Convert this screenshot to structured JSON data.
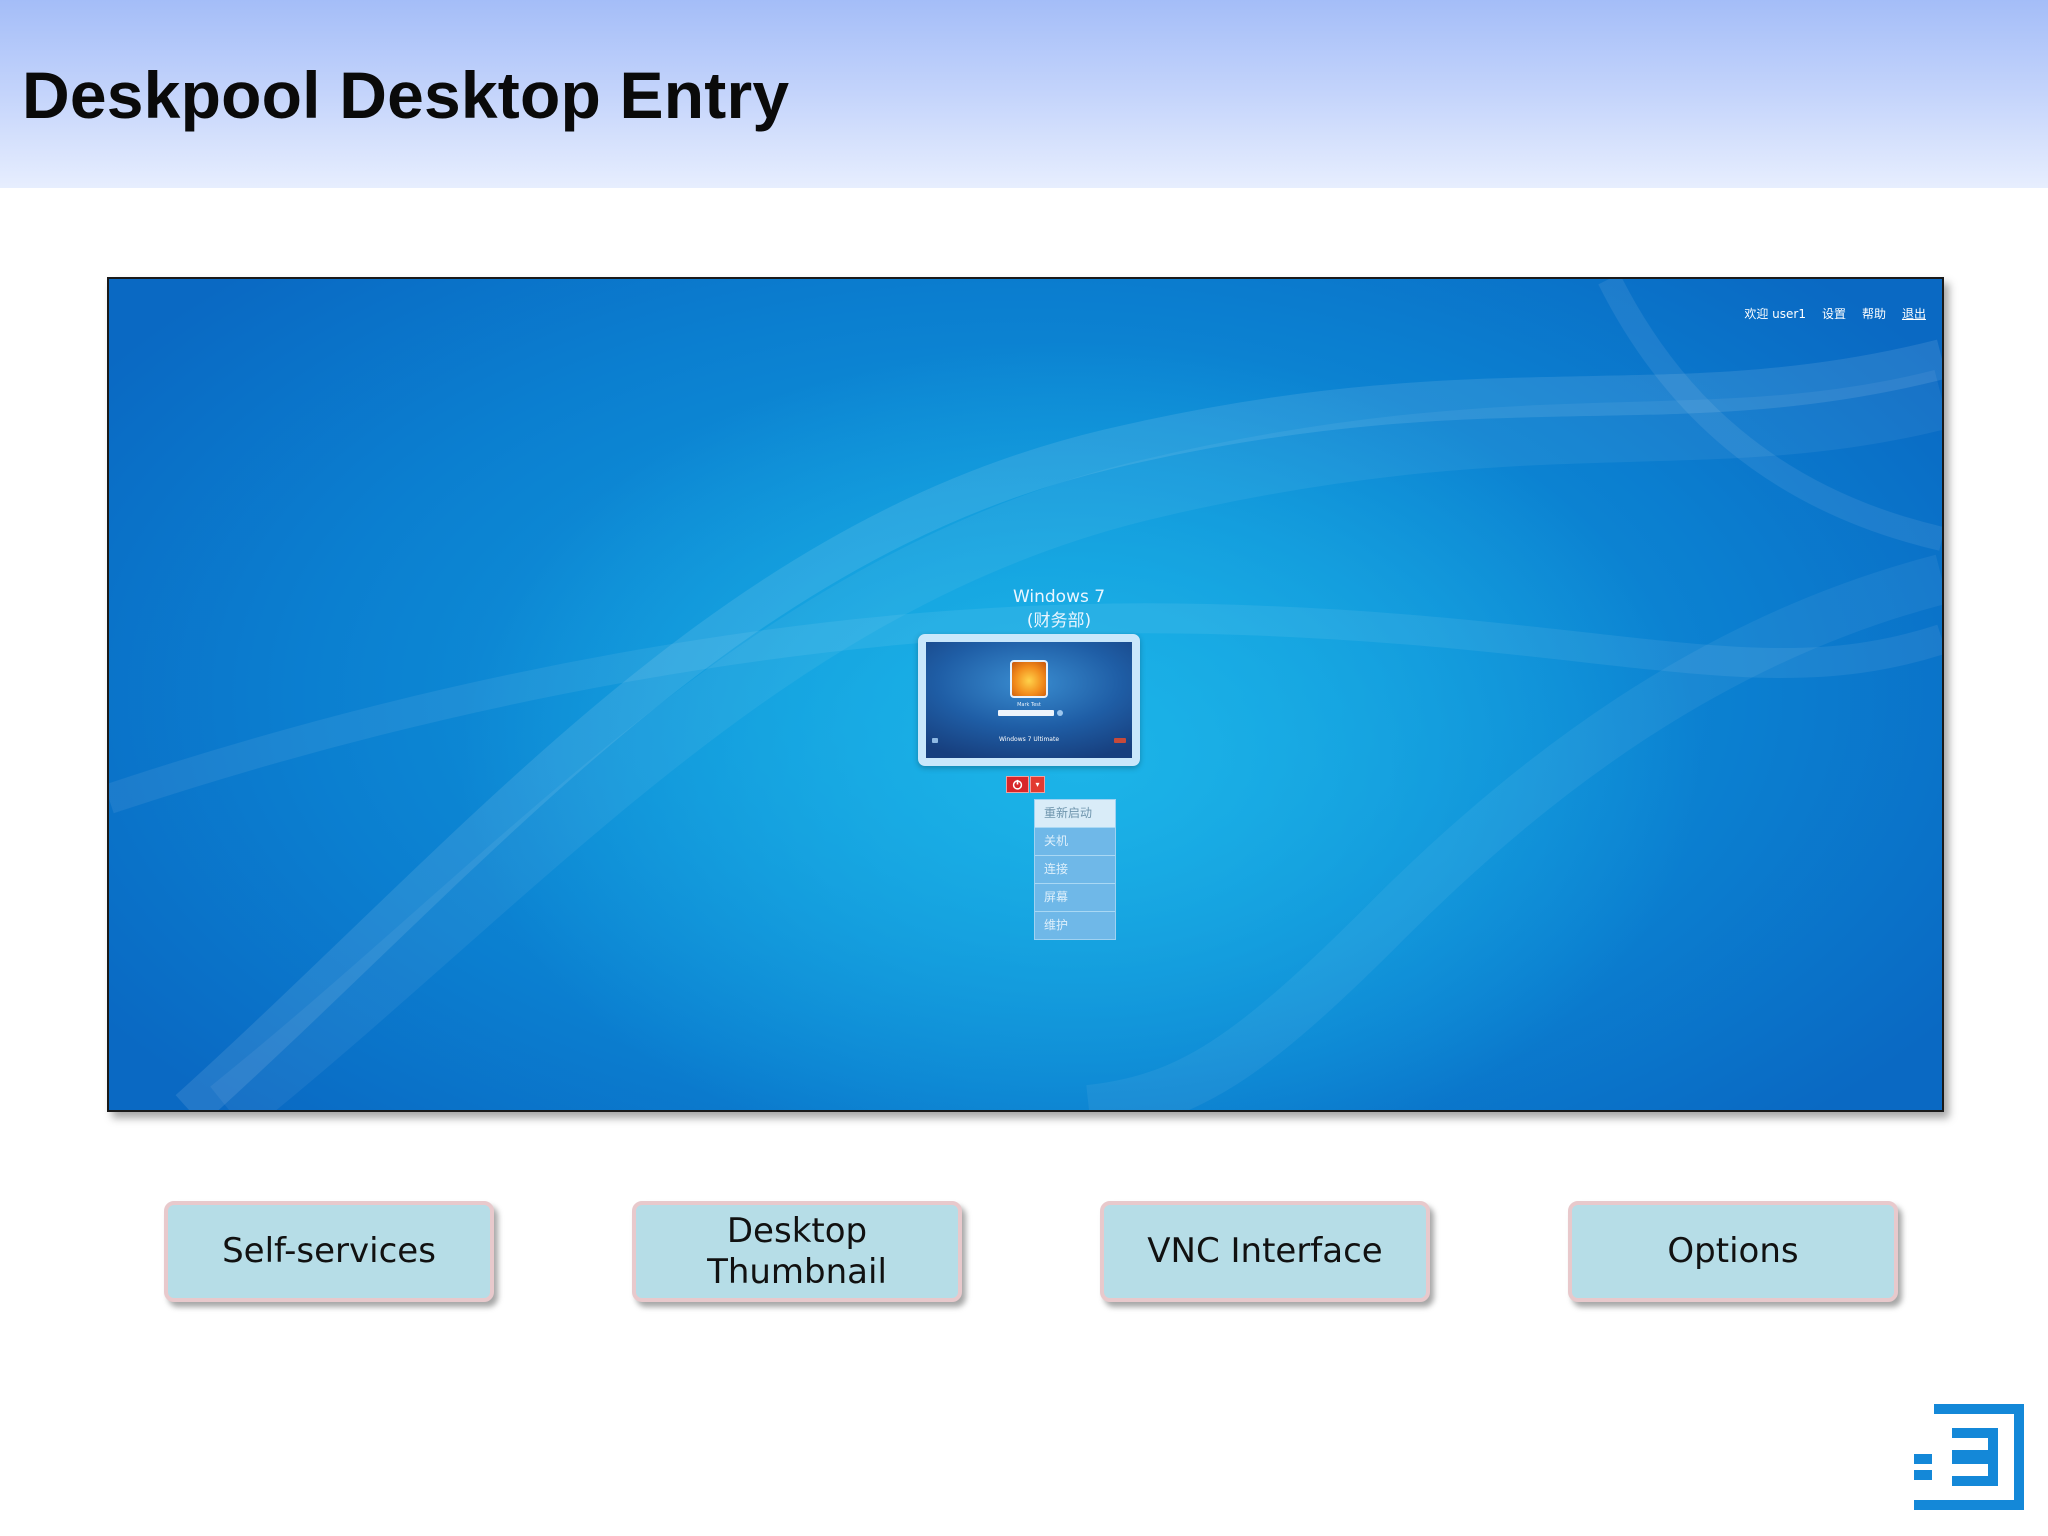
{
  "slide": {
    "title": "Deskpool Desktop Entry"
  },
  "portal": {
    "topbar": {
      "welcome": "欢迎 user1",
      "settings": "设置",
      "help": "帮助",
      "logout": "退出"
    },
    "desktop": {
      "name": "Windows 7",
      "group": "(财务部)",
      "thumbnail": {
        "user_name": "Mark Test",
        "brand": "Windows 7 Ultimate"
      }
    },
    "power_menu": {
      "items": [
        "重新启动",
        "关机",
        "连接",
        "屏幕",
        "维护"
      ]
    }
  },
  "buttons": {
    "self_services": "Self-services",
    "desktop_thumbnail_line1": "Desktop",
    "desktop_thumbnail_line2": "Thumbnail",
    "vnc_interface": "VNC Interface",
    "options": "Options"
  },
  "colors": {
    "header_gradient_top": "#a4bdf8",
    "desktop_blue": "#0b7fd0",
    "power_red": "#d8262a",
    "button_fill": "#b6dde7",
    "logo_blue": "#1488d8"
  },
  "icons": {
    "power": "power-icon",
    "dropdown": "caret-down-icon",
    "logo": "company-logo"
  }
}
